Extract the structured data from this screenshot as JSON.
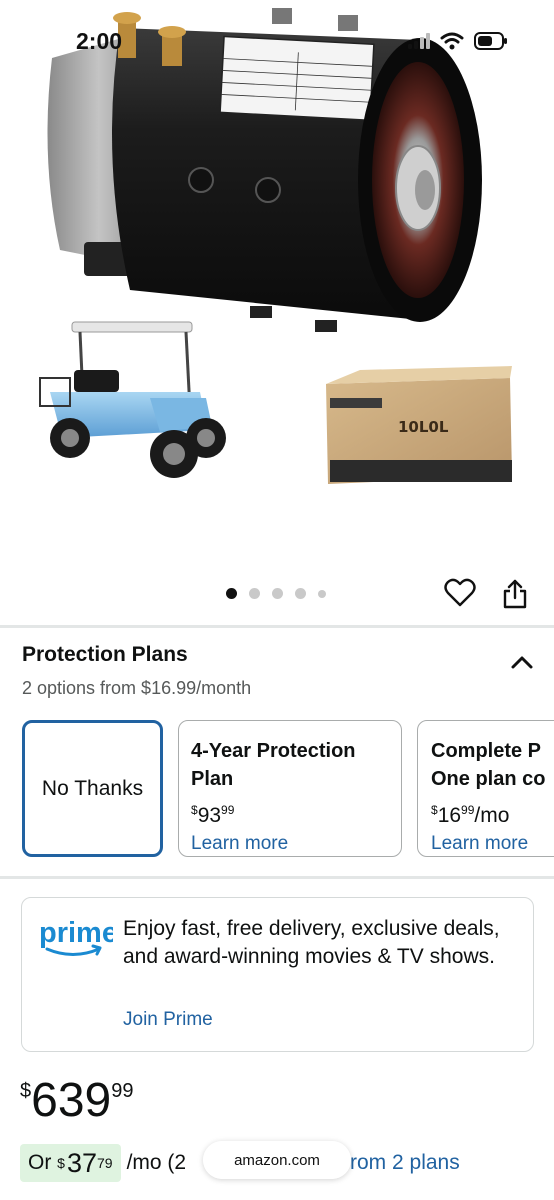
{
  "status_bar": {
    "time": "2:00"
  },
  "gallery": {
    "dot_count": 5,
    "active_index": 0,
    "box_brand": "10L0L"
  },
  "protection_plans": {
    "title": "Protection Plans",
    "subtitle": "2 options from $16.99/month",
    "options": [
      {
        "label": "No Thanks",
        "selected": true
      },
      {
        "name_line1": "4-Year Protection",
        "name_line2": "Plan",
        "price_currency": "$",
        "price_whole": "93",
        "price_fraction": "99",
        "price_suffix": "",
        "link": "Learn more"
      },
      {
        "name_line1": "Complete P",
        "name_line2": "One plan co",
        "price_currency": "$",
        "price_whole": "16",
        "price_fraction": "99",
        "price_suffix": "/mo",
        "link": "Learn more"
      }
    ]
  },
  "prime": {
    "logo_text": "prime",
    "description": "Enjoy fast, free delivery, exclusive deals, and award-winning movies & TV shows.",
    "link": "Join Prime"
  },
  "price": {
    "currency": "$",
    "whole": "639",
    "fraction": "99"
  },
  "monthly": {
    "prefix": "Or",
    "currency": "$",
    "whole": "37",
    "fraction": "79",
    "suffix": "/mo (2",
    "plans_text": "rom 2 plans"
  },
  "browser": {
    "url": "amazon.com"
  },
  "colors": {
    "link": "#2162a1",
    "selected_border": "#2162a1",
    "prime_blue": "#1a8ad1",
    "monthly_pill": "#dff3e0"
  }
}
